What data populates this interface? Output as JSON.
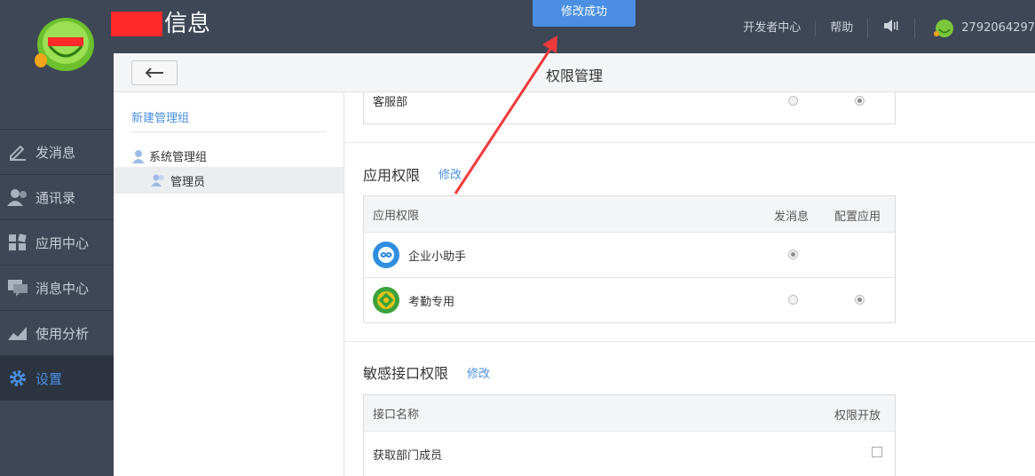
{
  "header": {
    "brand_title": "信息",
    "toast": "修改成功",
    "nav": [
      "开发者中心",
      "帮助"
    ],
    "username": "2792064297"
  },
  "leftnav": [
    {
      "label": "发消息",
      "icon": "pencil-icon"
    },
    {
      "label": "通讯录",
      "icon": "contacts-icon"
    },
    {
      "label": "应用中心",
      "icon": "apps-icon"
    },
    {
      "label": "消息中心",
      "icon": "message-icon"
    },
    {
      "label": "使用分析",
      "icon": "chart-icon"
    },
    {
      "label": "设置",
      "icon": "gear-icon",
      "active": true
    }
  ],
  "panel": {
    "title": "权限管理",
    "new_group": "新建管理组",
    "group": "系统管理组",
    "member": "管理员"
  },
  "dept_row": {
    "name": "客服部",
    "col1_checked": false,
    "col2_checked": true
  },
  "app_perm": {
    "title": "应用权限",
    "edit": "修改",
    "headers": [
      "应用权限",
      "发消息",
      "配置应用"
    ],
    "rows": [
      {
        "name": "企业小助手",
        "icon": "assistant-icon",
        "send": true,
        "config": null
      },
      {
        "name": "考勤专用",
        "icon": "attendance-icon",
        "send": false,
        "config": true
      }
    ]
  },
  "api_perm": {
    "title": "敏感接口权限",
    "edit": "修改",
    "headers": [
      "接口名称",
      "权限开放"
    ],
    "rows": [
      {
        "name": "获取部门成员",
        "open": false
      }
    ]
  },
  "colors": {
    "accent": "#4a8fe3",
    "sidebar": "#3d4755",
    "redact": "#ff2a2a",
    "arrow": "#f03a3a"
  }
}
